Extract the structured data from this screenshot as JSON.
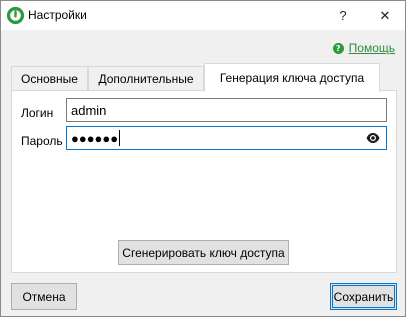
{
  "window": {
    "title": "Настройки",
    "help_button": "?",
    "close_button": "✕"
  },
  "help_link": {
    "label": "Помощь",
    "icon": "?"
  },
  "tabs": [
    {
      "label": "Основные",
      "active": false
    },
    {
      "label": "Дополнительные",
      "active": false
    },
    {
      "label": "Генерация ключа доступа",
      "active": true
    }
  ],
  "form": {
    "login_label": "Логин",
    "login_value": "admin",
    "password_label": "Пароль",
    "password_value": "●●●●●●",
    "generate_button": "Сгенерировать ключ доступа"
  },
  "footer": {
    "cancel_button": "Отмена",
    "save_button": "Сохранить"
  },
  "colors": {
    "accent": "#0078d7",
    "brand_green": "#2f9a3c",
    "link_green": "#2e8b38"
  }
}
